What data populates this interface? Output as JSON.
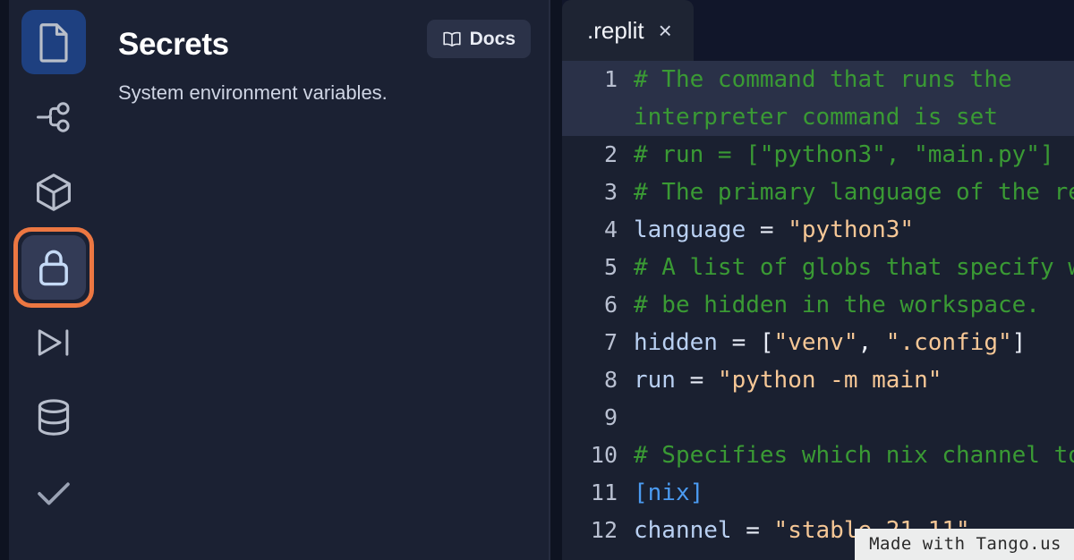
{
  "rail": {
    "items": [
      {
        "name": "files",
        "icon": "file-icon",
        "state": "active-blue"
      },
      {
        "name": "version-control",
        "icon": "git-branch-icon",
        "state": "normal"
      },
      {
        "name": "packages",
        "icon": "cube-icon",
        "state": "normal"
      },
      {
        "name": "secrets",
        "icon": "lock-icon",
        "state": "selected"
      },
      {
        "name": "deployments",
        "icon": "play-to-end-icon",
        "state": "normal"
      },
      {
        "name": "database",
        "icon": "database-icon",
        "state": "normal"
      },
      {
        "name": "checks",
        "icon": "check-icon",
        "state": "normal"
      }
    ],
    "highlight_color": "#ec7742",
    "active_color": "#1e4080"
  },
  "panel": {
    "title": "Secrets",
    "subtitle": "System environment variables.",
    "docs_label": "Docs",
    "docs_icon": "book-icon"
  },
  "editor": {
    "tab": {
      "label": ".replit",
      "close_label": "×"
    },
    "active_line": 1,
    "lines": [
      {
        "number": "1",
        "active": true,
        "wrapped": true,
        "tokens": [
          {
            "t": "comment",
            "s": "# The command that runs the "
          }
        ],
        "continuation": [
          {
            "t": "comment",
            "s": "interpreter command is set "
          }
        ]
      },
      {
        "number": "2",
        "active": false,
        "tokens": [
          {
            "t": "comment",
            "s": "# run = [\"python3\", \"main.py\"]"
          }
        ]
      },
      {
        "number": "3",
        "active": false,
        "tokens": [
          {
            "t": "comment",
            "s": "# The primary language of the repl."
          }
        ]
      },
      {
        "number": "4",
        "active": false,
        "tokens": [
          {
            "t": "var",
            "s": "language"
          },
          {
            "t": "op",
            "s": " = "
          },
          {
            "t": "str",
            "s": "\"python3\""
          }
        ]
      },
      {
        "number": "5",
        "active": false,
        "tokens": [
          {
            "t": "comment",
            "s": "# A list of globs that specify which files and directories should"
          }
        ]
      },
      {
        "number": "6",
        "active": false,
        "tokens": [
          {
            "t": "comment",
            "s": "# be hidden in the workspace."
          }
        ]
      },
      {
        "number": "7",
        "active": false,
        "tokens": [
          {
            "t": "var",
            "s": "hidden"
          },
          {
            "t": "op",
            "s": " = "
          },
          {
            "t": "punct",
            "s": "["
          },
          {
            "t": "str",
            "s": "\"venv\""
          },
          {
            "t": "punct",
            "s": ", "
          },
          {
            "t": "str",
            "s": "\".config\""
          },
          {
            "t": "punct",
            "s": "]"
          }
        ]
      },
      {
        "number": "8",
        "active": false,
        "tokens": [
          {
            "t": "var",
            "s": "run"
          },
          {
            "t": "op",
            "s": " = "
          },
          {
            "t": "str",
            "s": "\"python -m main\""
          }
        ]
      },
      {
        "number": "9",
        "active": false,
        "tokens": [
          {
            "t": "op",
            "s": ""
          }
        ]
      },
      {
        "number": "10",
        "active": false,
        "tokens": [
          {
            "t": "comment",
            "s": "# Specifies which nix channel to use when building the environment."
          }
        ]
      },
      {
        "number": "11",
        "active": false,
        "tokens": [
          {
            "t": "section",
            "s": "[nix]"
          }
        ]
      },
      {
        "number": "12",
        "active": false,
        "tokens": [
          {
            "t": "var",
            "s": "channel"
          },
          {
            "t": "op",
            "s": " = "
          },
          {
            "t": "str",
            "s": "\"stable-21_11\""
          }
        ]
      }
    ]
  },
  "watermark": {
    "label": "Made with Tango.us"
  }
}
